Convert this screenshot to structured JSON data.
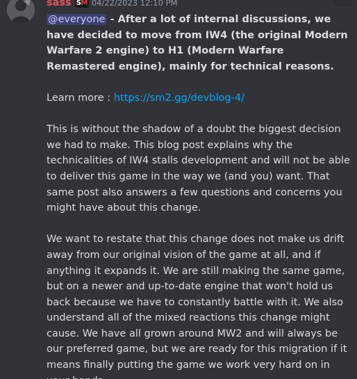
{
  "message": {
    "author": "sass",
    "badge": {
      "part1": "S",
      "part2": "M"
    },
    "timestamp": "04/22/2023 12:10 PM",
    "mention": "@everyone",
    "bold_text": " - After a lot of internal discussions, we have decided to move from IW4 (the original Modern Warfare 2 engine) to H1 (Modern Warfare Remastered engine), mainly for technical reasons.",
    "learn_more_label": "Learn more : ",
    "link": "https://sm2.gg/devblog-4/",
    "paragraph2": "This is without the shadow of a doubt the biggest decision we had to make. This blog post explains why the technicalities of IW4 stalls development and will not be able to deliver this game in the way we (and you) want. That same post also answers a few questions and concerns you might have about this change.",
    "paragraph3": " We want to restate that this change does not make us drift away from our original vision of the game at all, and if anything it expands it. We are still making the same game, but on a newer and up-to-date engine that won't hold us back because we have to constantly battle with it. We also understand all of the mixed reactions this change might cause. We have all grown around MW2 and will always be our preferred game, but we are ready for this migration if it means finally putting the game we work very hard on in your hands."
  },
  "colors": {
    "background": "#323339",
    "author": "#e35555",
    "link": "#00a8fc",
    "mention_bg": "#3c427a",
    "text": "#dbdee1",
    "timestamp": "#949ba4"
  }
}
